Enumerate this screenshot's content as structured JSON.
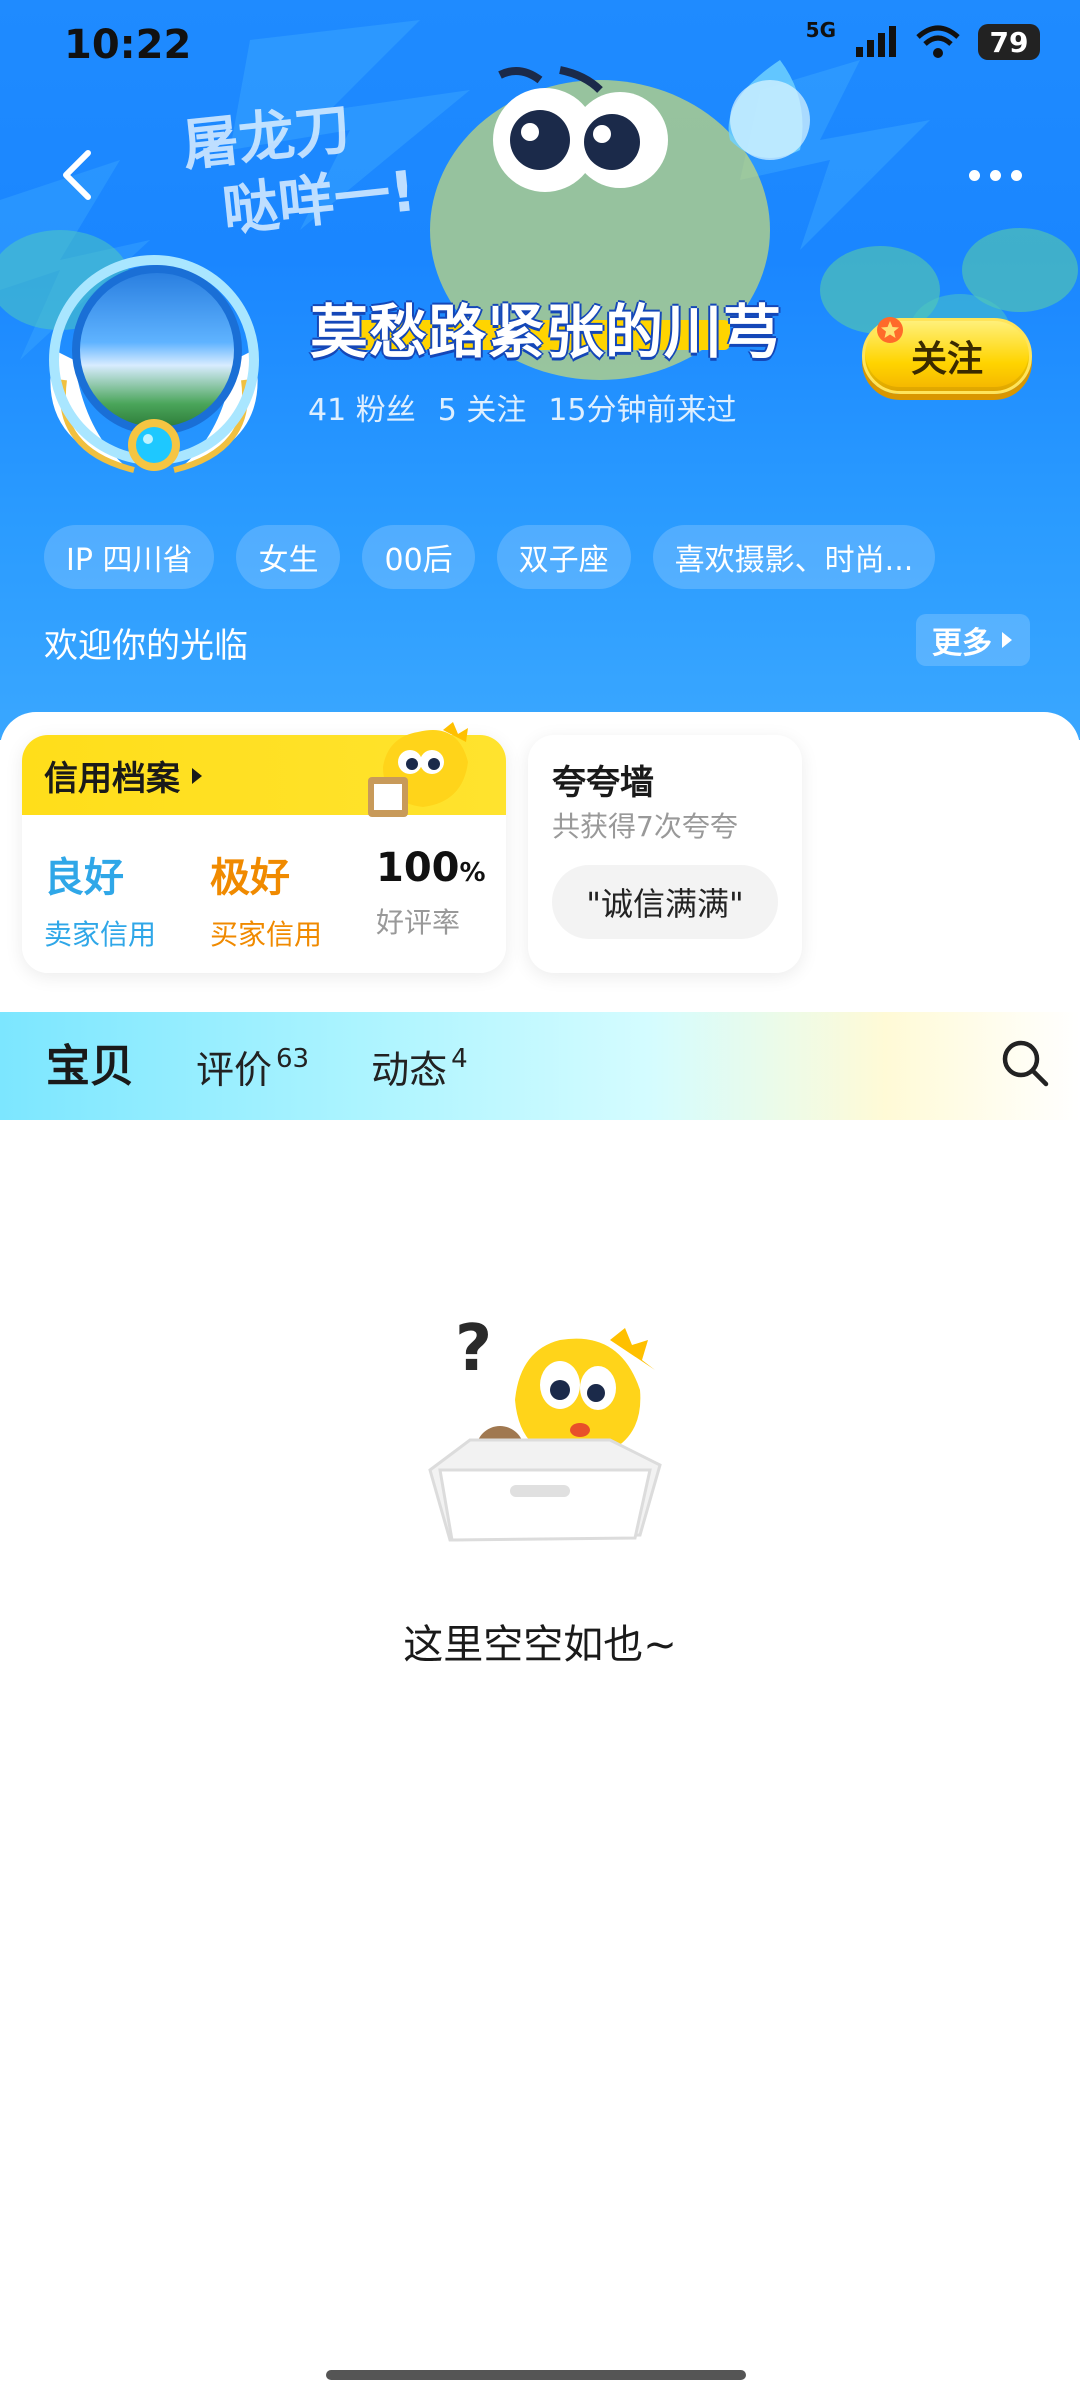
{
  "status_bar": {
    "time": "10:22",
    "network": "5G",
    "battery": "79"
  },
  "header": {
    "banner_text_line1": "屠龙刀",
    "banner_text_line2": "哒咩一!",
    "nickname": "莫愁路紧张的川芎",
    "stats": {
      "fans": "41 粉丝",
      "following": "5 关注",
      "last_seen": "15分钟前来过"
    },
    "follow_label": "关注",
    "tags": [
      "IP 四川省",
      "女生",
      "00后",
      "双子座",
      "喜欢摄影、时尚..."
    ],
    "welcome": "欢迎你的光临",
    "more_label": "更多"
  },
  "credit": {
    "title": "信用档案",
    "seller": {
      "value": "良好",
      "label": "卖家信用",
      "color": "#2fa7e8"
    },
    "buyer": {
      "value": "极好",
      "label": "买家信用",
      "color": "#f08a00"
    },
    "rating": {
      "value": "100",
      "unit": "%",
      "label": "好评率"
    }
  },
  "praise": {
    "title": "夸夸墙",
    "subtitle": "共获得7次夸夸",
    "badge": "\"诚信满满\""
  },
  "tabs": [
    {
      "label": "宝贝",
      "count": ""
    },
    {
      "label": "评价",
      "count": "63"
    },
    {
      "label": "动态",
      "count": "4"
    }
  ],
  "empty_state": {
    "text": "这里空空如也~"
  },
  "colors": {
    "header_blue": "#1f8bff",
    "accent_yellow": "#ffd400"
  }
}
